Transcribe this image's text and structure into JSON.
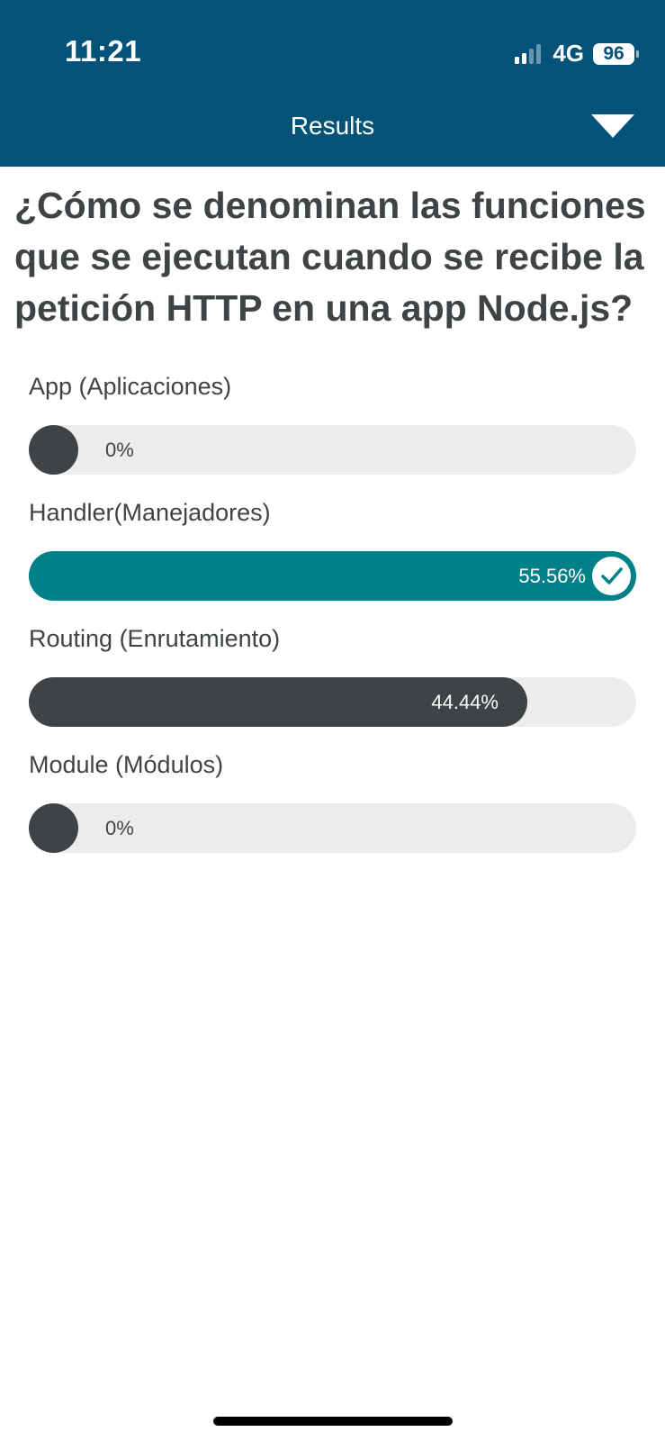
{
  "status_bar": {
    "time": "11:21",
    "network": "4G",
    "battery": "96",
    "signal_bars_active": 2,
    "signal_bars_total": 4
  },
  "header": {
    "title": "Results",
    "background": "#035278"
  },
  "question": "¿Cómo se denominan las funciones que se ejecutan cuando se recibe la petición HTTP en una app Node.js?",
  "options": [
    {
      "label": "App (Aplicaciones)",
      "percent_text": "0%",
      "percent": 0,
      "correct": false
    },
    {
      "label": "Handler(Manejadores)",
      "percent_text": "55.56%",
      "percent": 100,
      "correct": true
    },
    {
      "label": "Routing (Enrutamiento)",
      "percent_text": "44.44%",
      "percent": 82,
      "correct": false
    },
    {
      "label": "Module (Módulos)",
      "percent_text": "0%",
      "percent": 0,
      "correct": false
    }
  ],
  "colors": {
    "text": "#3e4446",
    "bar_default": "#3e4446",
    "bar_correct": "#008088",
    "track": "#ececec"
  },
  "icons": {
    "correct_icon": "check-circle-icon",
    "collapse_icon": "chevron-down-icon"
  }
}
